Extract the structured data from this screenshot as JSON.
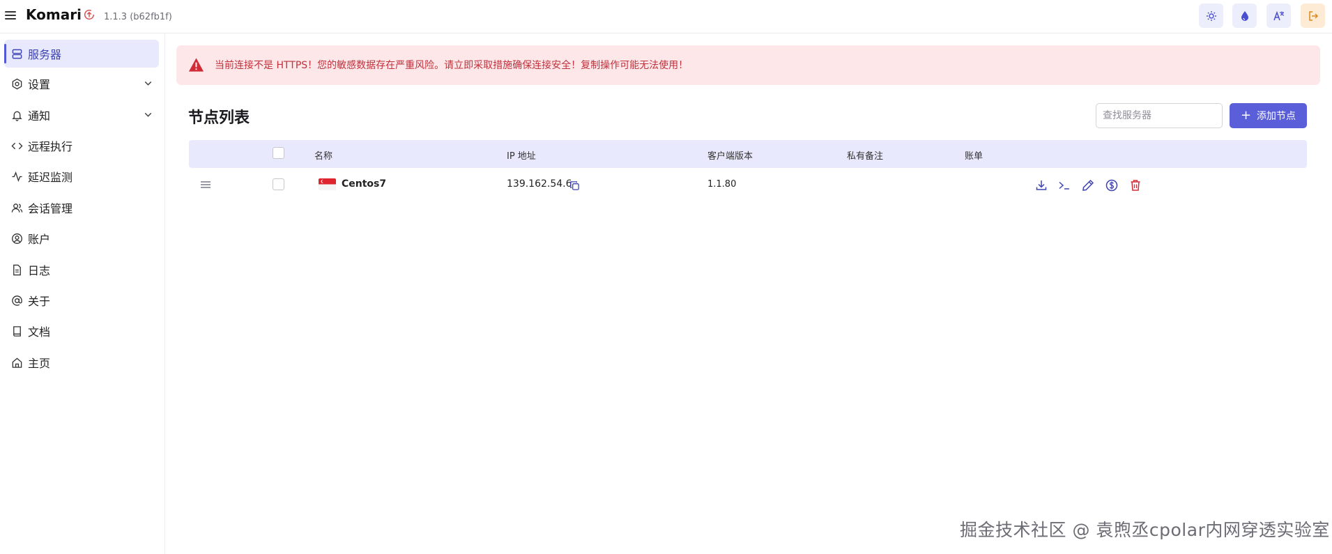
{
  "header": {
    "brand": "Komari",
    "version": "1.1.3 (b62fb1f)",
    "icons": [
      "menu-icon",
      "update-icon",
      "sun-icon",
      "color-drop-icon",
      "translate-icon",
      "logout-icon"
    ]
  },
  "sidebar": {
    "items": [
      {
        "label": "服务器",
        "icon": "server-icon",
        "active": true
      },
      {
        "label": "设置",
        "icon": "settings-icon",
        "expandable": true
      },
      {
        "label": "通知",
        "icon": "bell-icon",
        "expandable": true
      },
      {
        "label": "远程执行",
        "icon": "code-icon"
      },
      {
        "label": "延迟监测",
        "icon": "activity-icon"
      },
      {
        "label": "会话管理",
        "icon": "users-icon"
      },
      {
        "label": "账户",
        "icon": "user-circle-icon"
      },
      {
        "label": "日志",
        "icon": "file-icon"
      },
      {
        "label": "关于",
        "icon": "at-icon"
      },
      {
        "label": "文档",
        "icon": "book-icon"
      },
      {
        "label": "主页",
        "icon": "home-icon"
      }
    ]
  },
  "alert": {
    "text": "当前连接不是 HTTPS！您的敏感数据存在严重风险。请立即采取措施确保连接安全！复制操作可能无法使用！",
    "color": "#c0313c"
  },
  "main": {
    "title": "节点列表",
    "search_placeholder": "查找服务器",
    "add_button": "添加节点",
    "columns": [
      "名称",
      "IP 地址",
      "客户端版本",
      "私有备注",
      "账单"
    ],
    "rows": [
      {
        "name": "Centos7",
        "flag": "singapore-flag",
        "ip": "139.162.54.6",
        "client_version": "1.1.80",
        "note": "",
        "billing": ""
      }
    ],
    "row_actions": [
      "download-icon",
      "terminal-icon",
      "edit-icon",
      "billing-icon",
      "delete-icon"
    ]
  },
  "watermark": "掘金技术社区 @ 袁煦丞cpolar内网穿透实验室",
  "colors": {
    "accent": "#5a5fd9",
    "active_bg": "#e8e9fc",
    "alert_bg": "#fde7e9",
    "delete": "#d12b36"
  }
}
